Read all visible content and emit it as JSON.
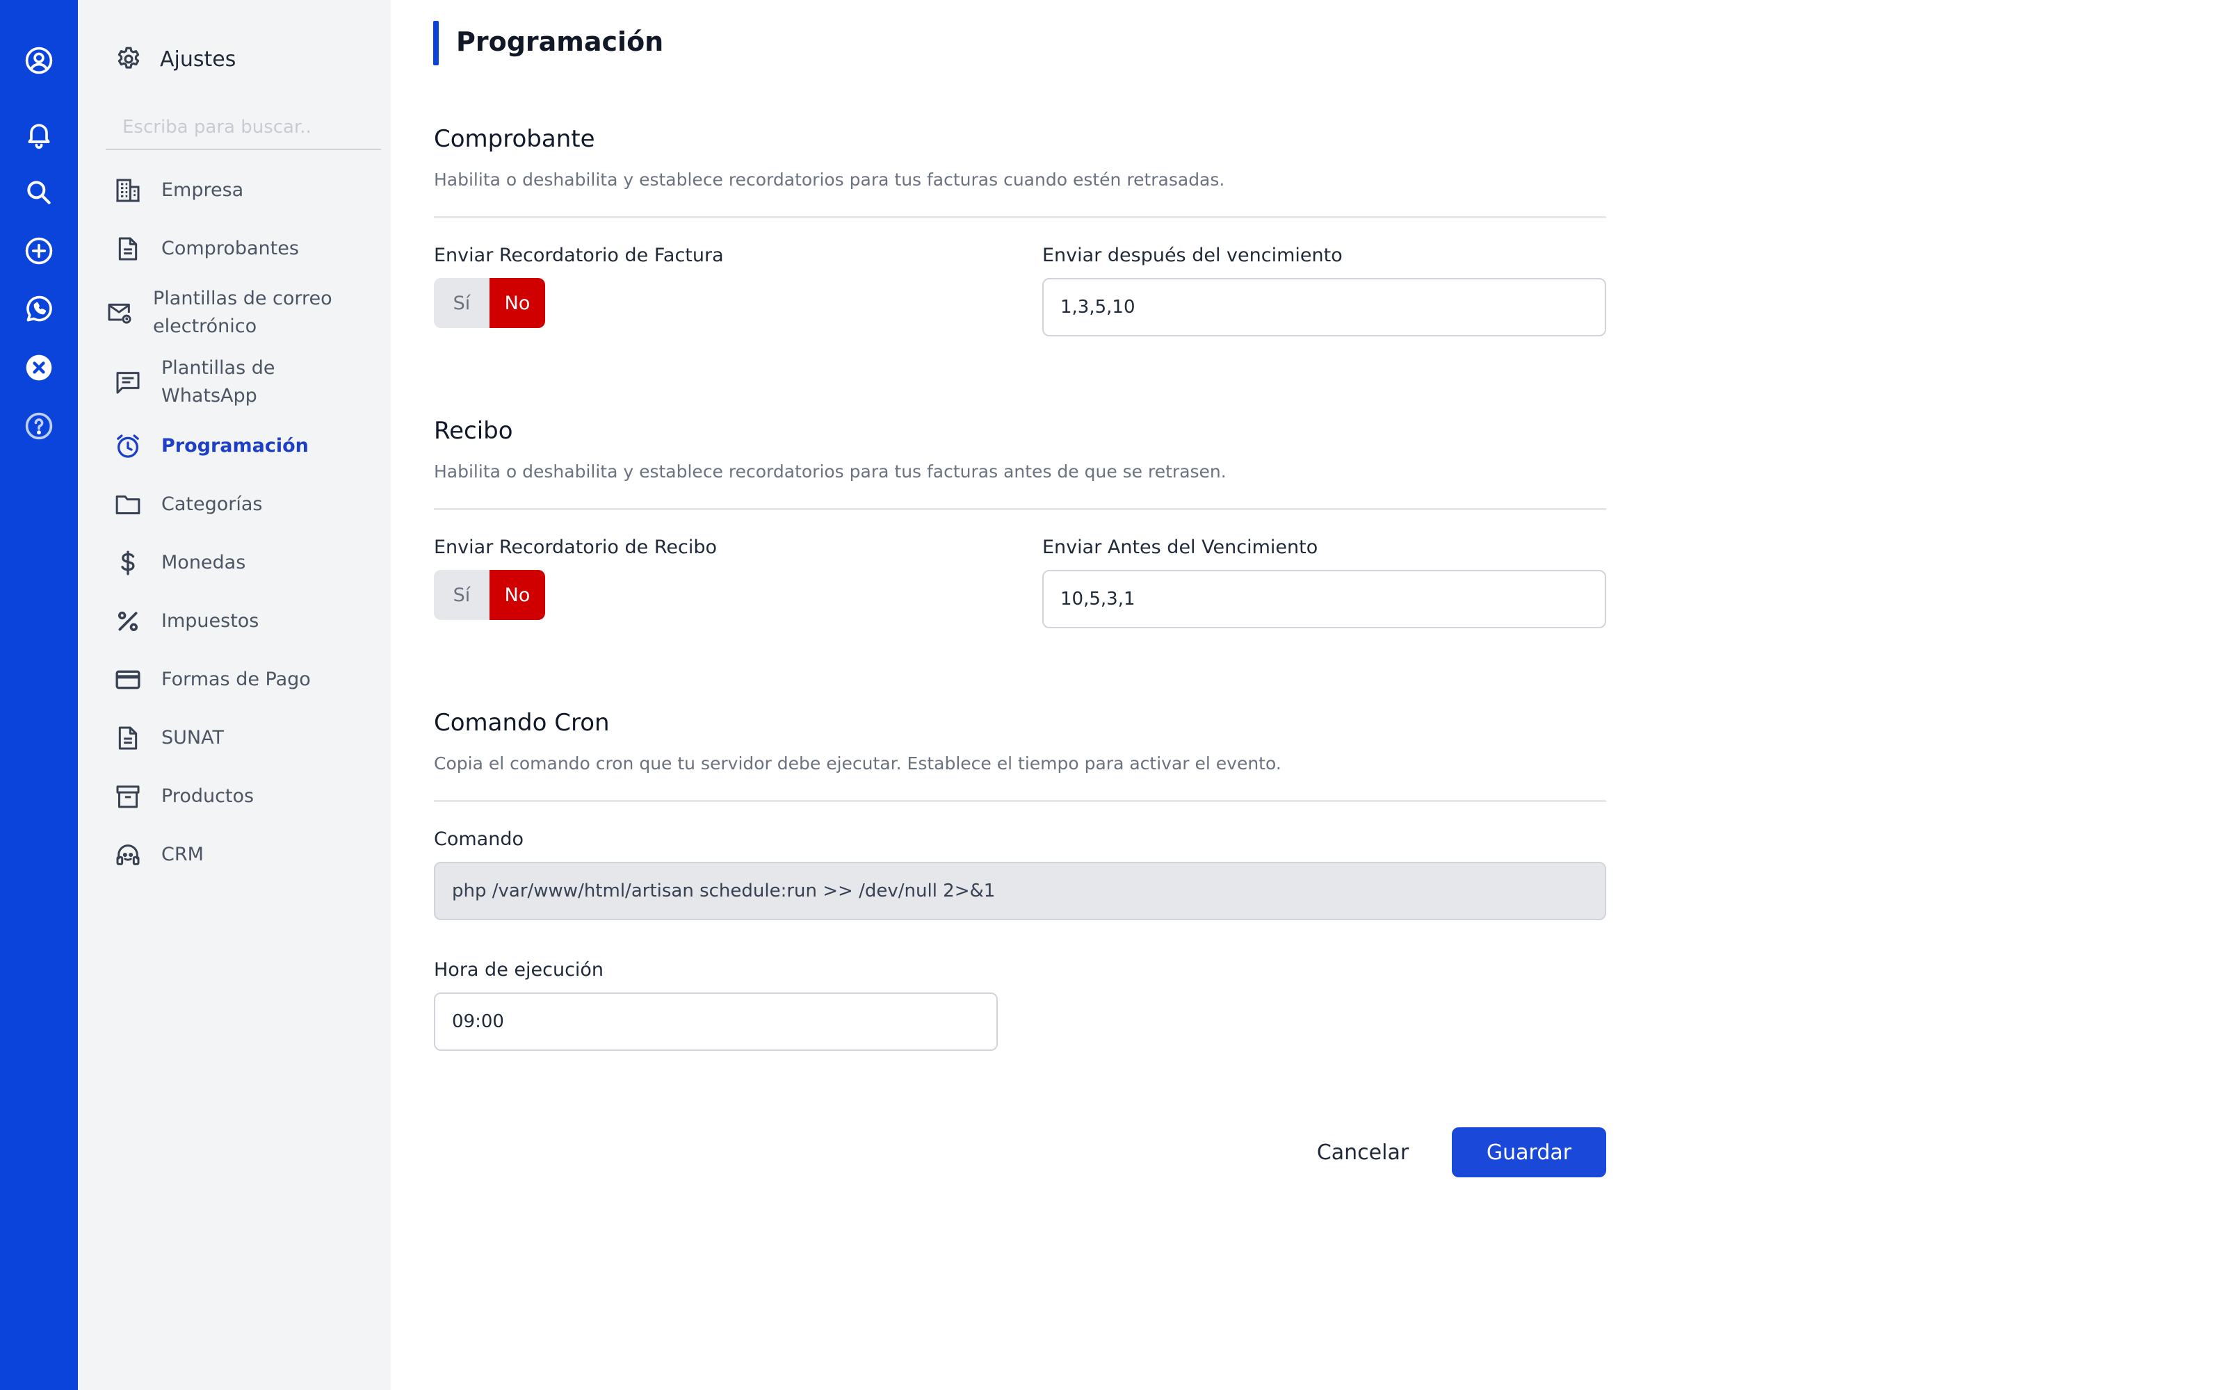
{
  "rail": {
    "icons": [
      "user-circle-icon",
      "bell-icon",
      "search-icon",
      "plus-circle-icon",
      "whatsapp-icon",
      "close-circle-icon",
      "help-circle-icon"
    ]
  },
  "sidebar": {
    "title": "Ajustes",
    "search_placeholder": "Escriba para buscar..",
    "items": [
      {
        "label": "Empresa",
        "icon": "building-icon"
      },
      {
        "label": "Comprobantes",
        "icon": "document-icon"
      },
      {
        "label": "Plantillas de correo electrónico",
        "icon": "mail-template-icon"
      },
      {
        "label": "Plantillas de WhatsApp",
        "icon": "chat-icon"
      },
      {
        "label": "Programación",
        "icon": "alarm-clock-icon",
        "active": true
      },
      {
        "label": "Categorías",
        "icon": "folder-icon"
      },
      {
        "label": "Monedas",
        "icon": "dollar-icon"
      },
      {
        "label": "Impuestos",
        "icon": "percent-icon"
      },
      {
        "label": "Formas de Pago",
        "icon": "credit-card-icon"
      },
      {
        "label": "SUNAT",
        "icon": "document-icon"
      },
      {
        "label": "Productos",
        "icon": "archive-box-icon"
      },
      {
        "label": "CRM",
        "icon": "headset-icon"
      }
    ]
  },
  "page": {
    "title": "Programación"
  },
  "sections": {
    "comprobante": {
      "title": "Comprobante",
      "description": "Habilita o deshabilita y establece recordatorios para tus facturas cuando estén retrasadas.",
      "toggle_label": "Enviar Recordatorio de Factura",
      "toggle_yes": "Sí",
      "toggle_no": "No",
      "toggle_value": "No",
      "days_label": "Enviar después del vencimiento",
      "days_value": "1,3,5,10"
    },
    "recibo": {
      "title": "Recibo",
      "description": "Habilita o deshabilita y establece recordatorios para tus facturas antes de que se retrasen.",
      "toggle_label": "Enviar Recordatorio de Recibo",
      "toggle_yes": "Sí",
      "toggle_no": "No",
      "toggle_value": "No",
      "days_label": "Enviar Antes del Vencimiento",
      "days_value": "10,5,3,1"
    },
    "cron": {
      "title": "Comando Cron",
      "description": "Copia el comando cron que tu servidor debe ejecutar. Establece el tiempo para activar el evento.",
      "command_label": "Comando",
      "command_value": "php /var/www/html/artisan schedule:run >> /dev/null 2>&1",
      "time_label": "Hora de ejecución",
      "time_value": "09:00"
    }
  },
  "actions": {
    "cancel_label": "Cancelar",
    "save_label": "Guardar"
  },
  "colors": {
    "brand": "#0b44db",
    "toggle_on": "#d10000",
    "save_button": "#1a48d8",
    "active_item": "#1e40c7"
  }
}
